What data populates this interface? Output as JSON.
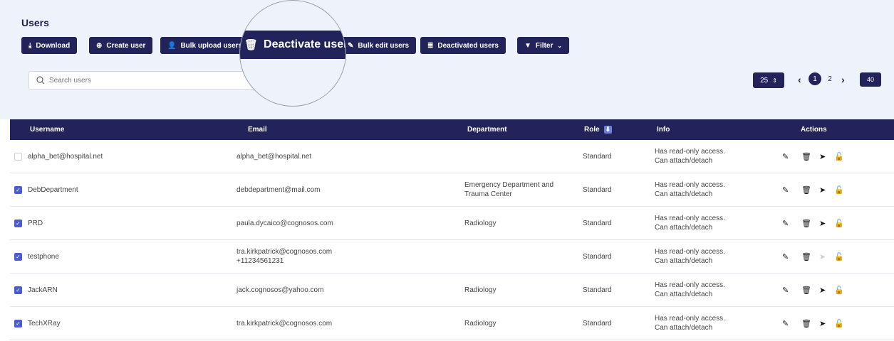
{
  "page": {
    "title": "Users"
  },
  "toolbar": {
    "download": "Download",
    "create_user": "Create user",
    "bulk_upload": "Bulk upload users",
    "deactivate": "Deactivate users",
    "bulk_edit": "Bulk edit users",
    "deactivated": "Deactivated users",
    "filter": "Filter"
  },
  "search": {
    "placeholder": "Search users"
  },
  "pagination": {
    "page_size": "25",
    "pages": [
      "1",
      "2"
    ],
    "current": "1",
    "last": "40"
  },
  "table": {
    "headers": {
      "username": "Username",
      "email": "Email",
      "department": "Department",
      "role": "Role",
      "info": "Info",
      "actions": "Actions"
    },
    "rows": [
      {
        "checked": false,
        "username": "alpha_bet@hospital.net",
        "email": "alpha_bet@hospital.net",
        "email2": "",
        "department": "",
        "department2": "",
        "role": "Standard",
        "info1": "Has read-only access.",
        "info2": "Can attach/detach",
        "send_disabled": false
      },
      {
        "checked": true,
        "username": "DebDepartment",
        "email": "debdepartment@mail.com",
        "email2": "",
        "department": "Emergency Department and",
        "department2": "Trauma Center",
        "role": "Standard",
        "info1": "Has read-only access.",
        "info2": "Can attach/detach",
        "send_disabled": false
      },
      {
        "checked": true,
        "username": "PRD",
        "email": "paula.dycaico@cognosos.com",
        "email2": "",
        "department": "Radiology",
        "department2": "",
        "role": "Standard",
        "info1": "Has read-only access.",
        "info2": "Can attach/detach",
        "send_disabled": false
      },
      {
        "checked": true,
        "username": "testphone",
        "email": "tra.kirkpatrick@cognosos.com",
        "email2": "+11234561231",
        "department": "",
        "department2": "",
        "role": "Standard",
        "info1": "Has read-only access.",
        "info2": "Can attach/detach",
        "send_disabled": true
      },
      {
        "checked": true,
        "username": "JackARN",
        "email": "jack.cognosos@yahoo.com",
        "email2": "",
        "department": "Radiology",
        "department2": "",
        "role": "Standard",
        "info1": "Has read-only access.",
        "info2": "Can attach/detach",
        "send_disabled": false
      },
      {
        "checked": true,
        "username": "TechXRay",
        "email": "tra.kirkpatrick@cognosos.com",
        "email2": "",
        "department": "Radiology",
        "department2": "",
        "role": "Standard",
        "info1": "Has read-only access.",
        "info2": "Can attach/detach",
        "send_disabled": false
      }
    ]
  },
  "colors": {
    "navy": "#22235a",
    "header_bg": "#eef2fb",
    "checkbox": "#4b5bd0"
  }
}
